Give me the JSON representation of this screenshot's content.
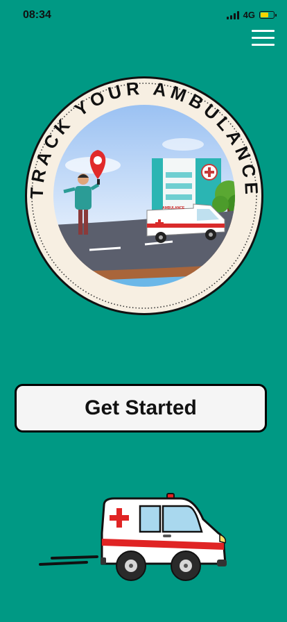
{
  "status_bar": {
    "time": "08:34",
    "network": "4G",
    "battery_level": 0.55
  },
  "header": {
    "menu_icon": "hamburger-menu-icon"
  },
  "badge": {
    "arc_text": "TRACK YOUR AMBULANCE",
    "vehicle_label": "AMBULANCE",
    "icons": [
      "location-pin-icon",
      "hospital-building-icon",
      "ambulance-van-icon",
      "person-with-phone-icon",
      "tree-icon"
    ]
  },
  "cta": {
    "label": "Get Started"
  },
  "colors": {
    "background": "#009984",
    "button_bg": "#f5f5f5",
    "button_border": "#000000",
    "badge_bg": "#f7efe2",
    "ambulance_red": "#e02424"
  }
}
